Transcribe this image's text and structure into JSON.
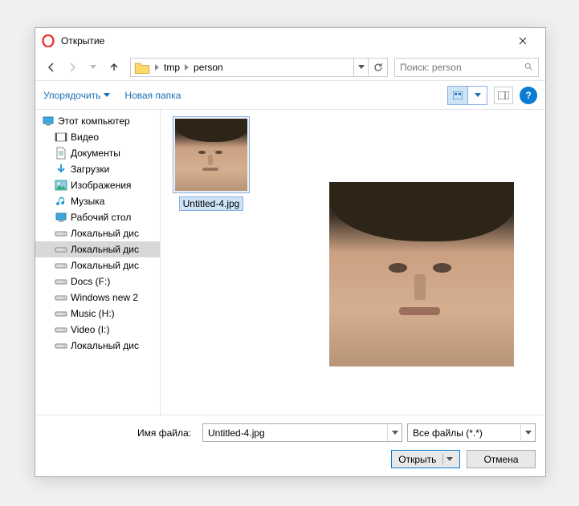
{
  "window": {
    "title": "Открытие"
  },
  "breadcrumb": {
    "segments": [
      "tmp",
      "person"
    ]
  },
  "search": {
    "placeholder": "Поиск: person"
  },
  "toolbar": {
    "organize": "Упорядочить",
    "newfolder": "Новая папка"
  },
  "tree": {
    "root": "Этот компьютер",
    "items": [
      {
        "label": "Видео",
        "icon": "video"
      },
      {
        "label": "Документы",
        "icon": "doc"
      },
      {
        "label": "Загрузки",
        "icon": "download"
      },
      {
        "label": "Изображения",
        "icon": "image"
      },
      {
        "label": "Музыка",
        "icon": "music"
      },
      {
        "label": "Рабочий стол",
        "icon": "desktop"
      },
      {
        "label": "Локальный дис",
        "icon": "drive"
      },
      {
        "label": "Локальный дис",
        "icon": "drive",
        "selected": true
      },
      {
        "label": "Локальный дис",
        "icon": "drive"
      },
      {
        "label": "Docs (F:)",
        "icon": "drive"
      },
      {
        "label": "Windows new 2",
        "icon": "drive"
      },
      {
        "label": "Music (H:)",
        "icon": "drive"
      },
      {
        "label": "Video (I:)",
        "icon": "drive"
      },
      {
        "label": "Локальный дис",
        "icon": "drive"
      }
    ]
  },
  "files": {
    "selected": "Untitled-4.jpg"
  },
  "footer": {
    "filename_label": "Имя файла:",
    "filename_value": "Untitled-4.jpg",
    "filter": "Все файлы (*.*)",
    "open": "Открыть",
    "cancel": "Отмена"
  }
}
